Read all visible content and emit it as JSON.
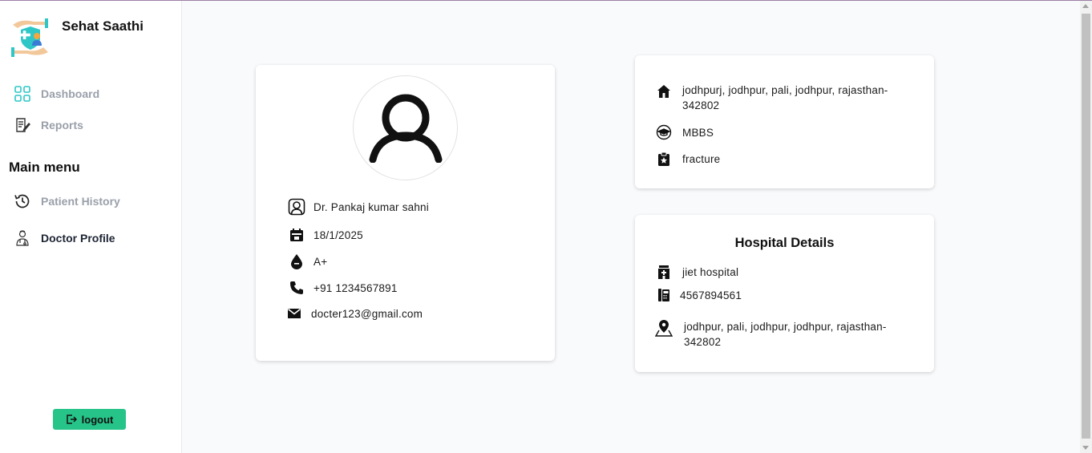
{
  "app": {
    "title": "Sehat Saathi"
  },
  "sidebar": {
    "nav": [
      {
        "label": "Dashboard",
        "icon": "dashboard-icon"
      },
      {
        "label": "Reports",
        "icon": "reports-icon"
      }
    ],
    "menu_heading": "Main menu",
    "menu": [
      {
        "label": "Patient History",
        "icon": "history-icon"
      },
      {
        "label": "Doctor Profile",
        "icon": "doctor-icon",
        "active": true
      }
    ],
    "logout_label": "logout"
  },
  "profile": {
    "name": "Dr.  Pankaj  kumar  sahni",
    "date": "18/1/2025",
    "blood_group": "A+",
    "phone": "+91  1234567891",
    "email": "docter123@gmail.com"
  },
  "details": {
    "address": "jodhpurj, jodhpur, pali, jodhpur, rajasthan-342802",
    "degree": "MBBS",
    "specialization": "fracture"
  },
  "hospital": {
    "title": "Hospital Details",
    "name": "jiet hospital",
    "phone": "4567894561",
    "address": "jodhpur, pali, jodhpur, jodhpur, rajasthan-342802"
  },
  "colors": {
    "accent": "#27c48a",
    "page_bg": "#f9fafc",
    "muted_text": "#9aa0aa",
    "dashboard_icon": "#2ec6c6"
  }
}
